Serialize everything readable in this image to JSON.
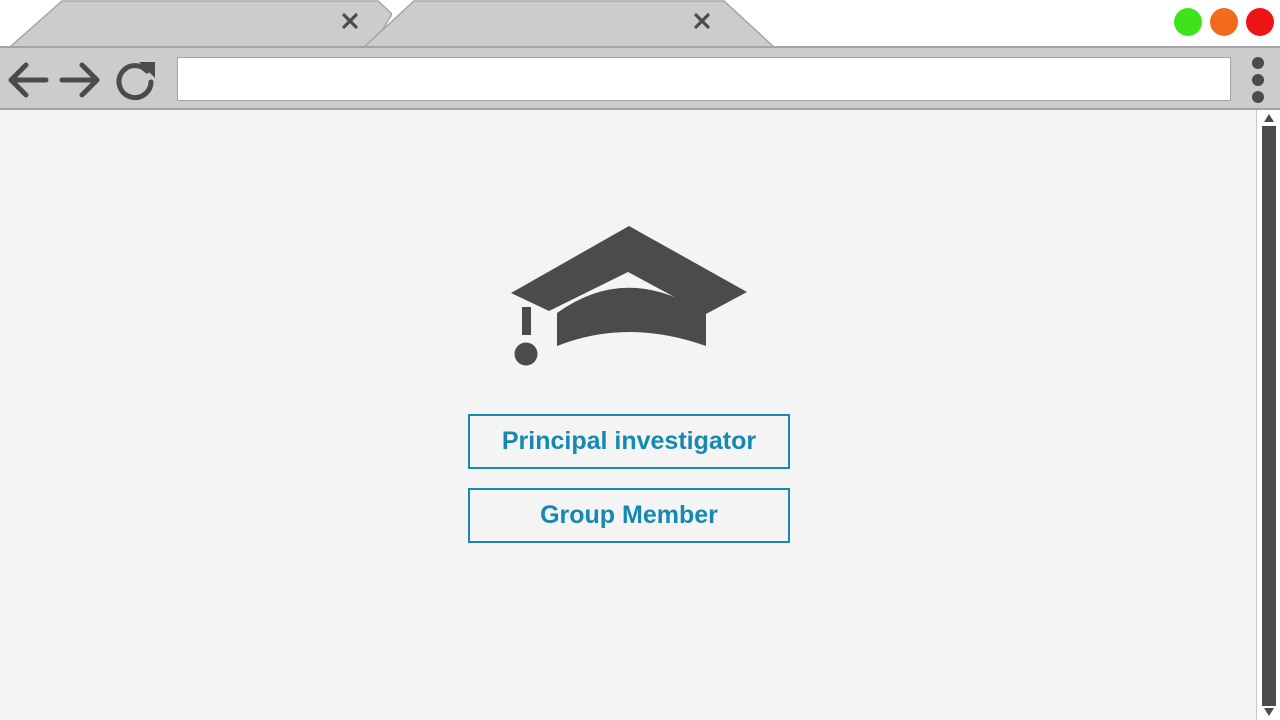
{
  "tabs": [
    {
      "icon": "close-icon"
    },
    {
      "icon": "close-icon"
    }
  ],
  "window_controls": [
    {
      "name": "green",
      "color": "#3fe31c"
    },
    {
      "name": "orange",
      "color": "#f26b1d"
    },
    {
      "name": "red",
      "color": "#ee1515"
    }
  ],
  "toolbar": {
    "back_icon": "arrow-left-icon",
    "forward_icon": "arrow-right-icon",
    "reload_icon": "reload-icon",
    "menu_icon": "kebab-menu-icon",
    "address_value": ""
  },
  "content": {
    "hero_icon": "graduation-cap-icon",
    "buttons": {
      "principal_investigator": "Principal investigator",
      "group_member": "Group Member"
    }
  },
  "colors": {
    "accent": "#1589b1",
    "icon": "#4b4b4b",
    "chrome": "#cccccc"
  }
}
